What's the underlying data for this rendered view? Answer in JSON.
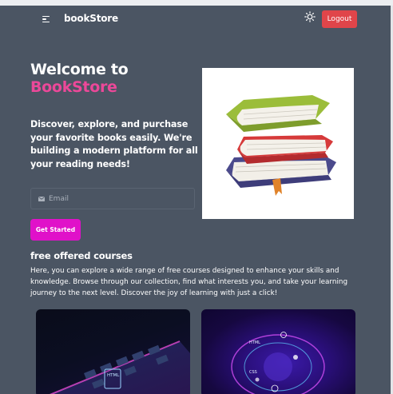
{
  "nav": {
    "brand": "bookStore",
    "logout_label": "Logout",
    "menu_icon": "hamburger-icon",
    "theme_icon": "sun-icon"
  },
  "hero": {
    "title_line1": "Welcome to",
    "title_line2": "BookStore",
    "lead": "Discover, explore, and purchase your favorite books easily. We're building a modern platform for all your reading needs!",
    "email_placeholder": "Email",
    "cta_label": "Get Started",
    "image_icon": "books-stack-illustration"
  },
  "courses": {
    "title": "free offered courses",
    "description": "Here, you can explore a wide range of free courses designed to enhance your skills and knowledge. Browse through our collection, find what interests you, and take your learning journey to the next level. Discover the joy of learning with just a click!",
    "cards": [
      {
        "image": "keyboard-html-image",
        "badge": "HTML"
      },
      {
        "image": "web-technologies-image",
        "badge_top": "HTML",
        "badge_mid": "CSS"
      }
    ]
  },
  "colors": {
    "page_bg": "#4b5563",
    "accent_pink": "#ec4899",
    "logout_red": "#e0454a",
    "cta_magenta": "#e011c9"
  }
}
